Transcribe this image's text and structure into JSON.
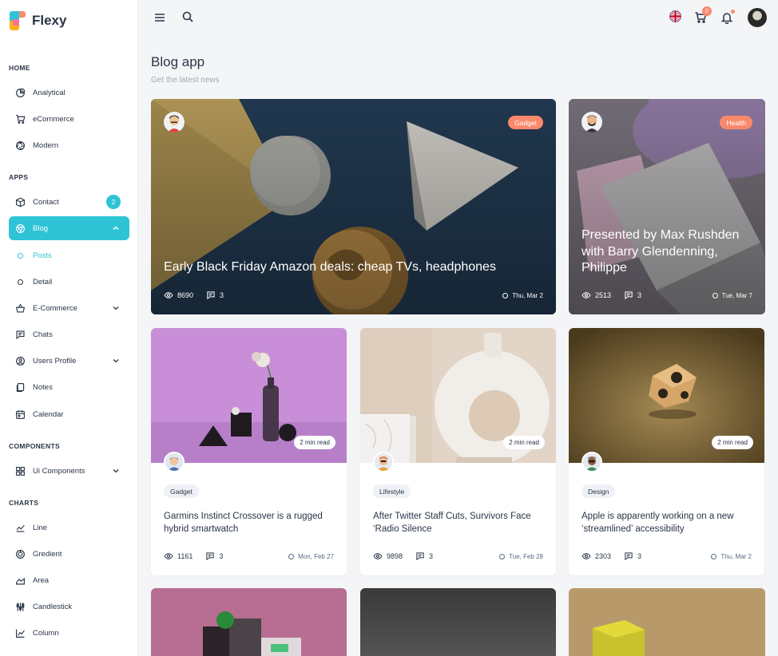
{
  "brand": {
    "name": "Flexy"
  },
  "sidebar": {
    "sections": {
      "home": "HOME",
      "apps": "APPS",
      "components": "COMPONENTS",
      "charts": "CHARTS"
    },
    "items": {
      "analytical": "Analytical",
      "ecommerce": "eCommerce",
      "modern": "Modern",
      "contact": "Contact",
      "contact_badge": "2",
      "blog": "Blog",
      "posts": "Posts",
      "detail": "Detail",
      "e_commerce": "E-Commerce",
      "chats": "Chats",
      "users_profile": "Users Profile",
      "notes": "Notes",
      "calendar": "Calendar",
      "ui_components": "Ui Components",
      "line": "Line",
      "gradient": "Gredient",
      "area": "Area",
      "candlestick": "Candlestick",
      "column": "Column"
    }
  },
  "topbar": {
    "cart_count": "0"
  },
  "page": {
    "title": "Blog app",
    "subtitle": "Get the latest news"
  },
  "featured": [
    {
      "tag": "Gadget",
      "title": "Early Black Friday Amazon deals: cheap TVs, headphones",
      "views": "8690",
      "comments": "3",
      "date": "Thu, Mar 2"
    },
    {
      "tag": "Health",
      "title": "Presented by Max Rushden with Barry Glendenning, Philippe",
      "views": "2513",
      "comments": "3",
      "date": "Tue, Mar 7"
    }
  ],
  "posts": [
    {
      "read": "2 min read",
      "tag": "Gadget",
      "title": "Garmins Instinct Crossover is a rugged hybrid smartwatch",
      "views": "1161",
      "comments": "3",
      "date": "Mon, Feb 27"
    },
    {
      "read": "2 min read",
      "tag": "Lifestyle",
      "title": "After Twitter Staff Cuts, Survivors Face ‘Radio Silence",
      "views": "9898",
      "comments": "3",
      "date": "Tue, Feb 28"
    },
    {
      "read": "2 min read",
      "tag": "Design",
      "title": "Apple is apparently working on a new ‘streamlined’ accessibility",
      "views": "2303",
      "comments": "3",
      "date": "Thu, Mar 2"
    }
  ],
  "colors": {
    "primary": "#2ec4d6",
    "accent": "#fa896b",
    "text": "#2a3547",
    "muted": "#a1a8b4"
  }
}
